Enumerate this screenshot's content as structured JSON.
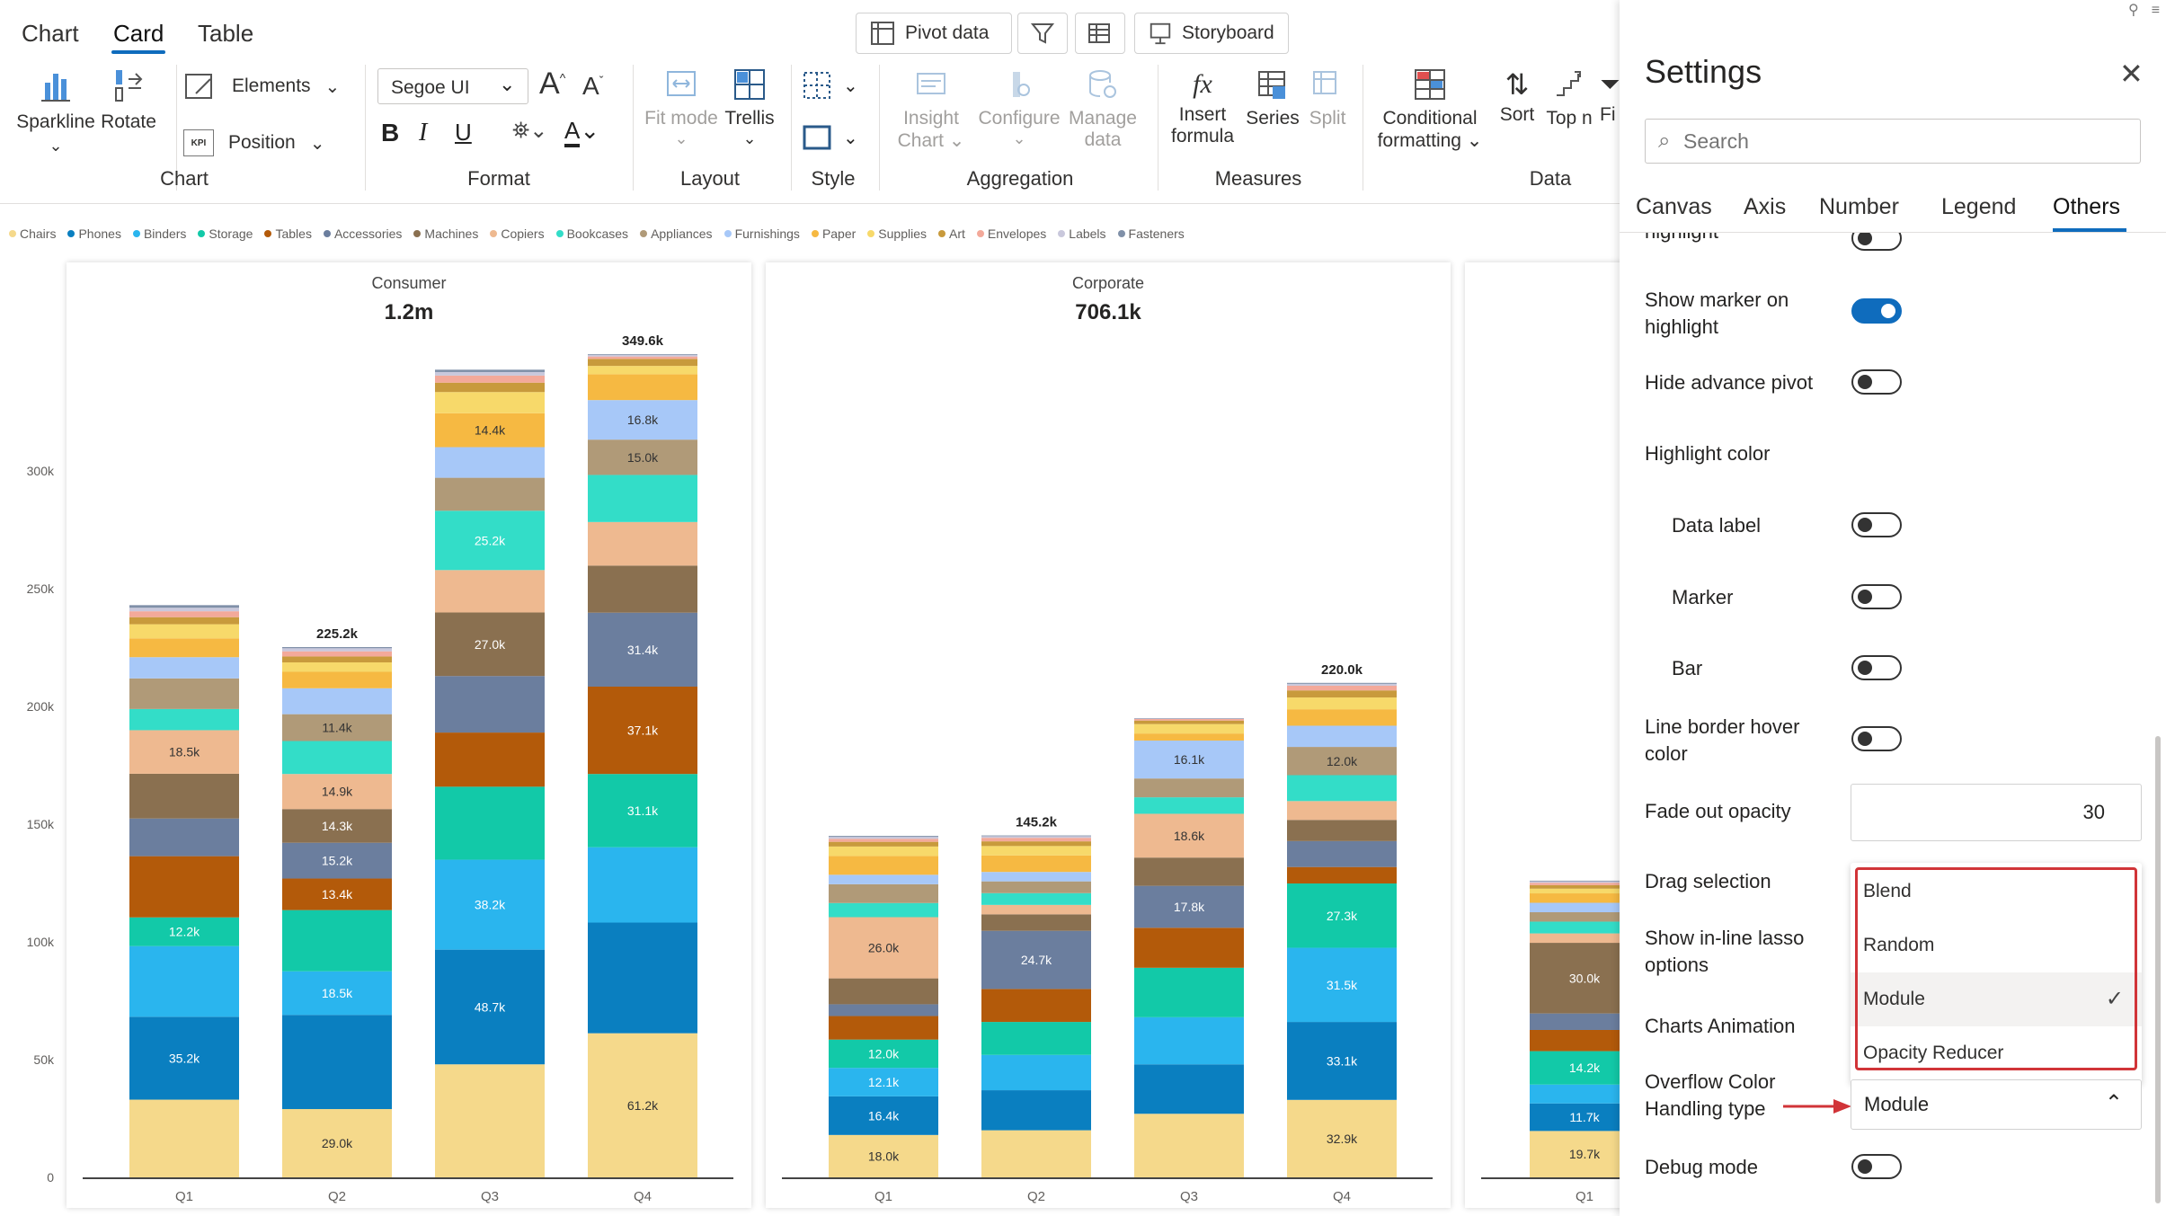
{
  "top_tabs": [
    "Chart",
    "Card",
    "Table"
  ],
  "top_buttons": {
    "pivot": "Pivot data",
    "storyboard": "Storyboard"
  },
  "ribbon": {
    "sparkline": "Sparkline",
    "rotate": "Rotate",
    "elements": "Elements",
    "position": "Position",
    "kpi": "KPI",
    "font_name": "Segoe UI",
    "fit_mode": "Fit mode",
    "trellis": "Trellis",
    "insight_chart_1": "Insight",
    "insight_chart_2": "Chart",
    "configure": "Configure",
    "manage_1": "Manage",
    "manage_2": "data",
    "insert_1": "Insert",
    "insert_2": "formula",
    "series": "Series",
    "split": "Split",
    "cond_1": "Conditional",
    "cond_2": "formatting",
    "sort": "Sort",
    "topn": "Top n",
    "fi": "Fi",
    "groups": {
      "chart": "Chart",
      "format": "Format",
      "layout": "Layout",
      "style": "Style",
      "aggregation": "Aggregation",
      "measures": "Measures",
      "data": "Data"
    }
  },
  "legend": [
    {
      "name": "Chairs",
      "color": "#f5d98b"
    },
    {
      "name": "Phones",
      "color": "#0a7fc0"
    },
    {
      "name": "Binders",
      "color": "#2ab5ee"
    },
    {
      "name": "Storage",
      "color": "#12c9a8"
    },
    {
      "name": "Tables",
      "color": "#b35a0a"
    },
    {
      "name": "Accessories",
      "color": "#6b7e9e"
    },
    {
      "name": "Machines",
      "color": "#8a7050"
    },
    {
      "name": "Copiers",
      "color": "#eeb990"
    },
    {
      "name": "Bookcases",
      "color": "#33ddc8"
    },
    {
      "name": "Appliances",
      "color": "#b09a78"
    },
    {
      "name": "Furnishings",
      "color": "#a7c8f8"
    },
    {
      "name": "Paper",
      "color": "#f6b942"
    },
    {
      "name": "Supplies",
      "color": "#f7d96a"
    },
    {
      "name": "Art",
      "color": "#c89a3c"
    },
    {
      "name": "Envelopes",
      "color": "#f3a99a"
    },
    {
      "name": "Labels",
      "color": "#c9c8dc"
    },
    {
      "name": "Fasteners",
      "color": "#8090a8"
    }
  ],
  "y_axis": [
    "300k",
    "250k",
    "200k",
    "150k",
    "100k",
    "50k",
    "0"
  ],
  "chart_data": [
    {
      "type": "bar",
      "title": "Consumer",
      "subtitle": "1.2m",
      "categories": [
        "Q1",
        "Q2",
        "Q3",
        "Q4"
      ],
      "ylim": [
        0,
        370000
      ],
      "stack_order": [
        "Chairs",
        "Phones",
        "Binders",
        "Storage",
        "Tables",
        "Accessories",
        "Machines",
        "Copiers",
        "Bookcases",
        "Appliances",
        "Furnishings",
        "Paper",
        "Supplies",
        "Art",
        "Envelopes",
        "Labels",
        "Fasteners"
      ],
      "bars": [
        {
          "total": 243000,
          "total_label": "",
          "segments": [
            [
              33000,
              ""
            ],
            [
              35200,
              "35.2k"
            ],
            [
              30000,
              ""
            ],
            [
              12200,
              "12.2k"
            ],
            [
              26000,
              ""
            ],
            [
              16000,
              ""
            ],
            [
              19000,
              ""
            ],
            [
              18500,
              "18.5k"
            ],
            [
              9000,
              ""
            ],
            [
              13000,
              ""
            ],
            [
              9000,
              ""
            ],
            [
              8000,
              ""
            ],
            [
              6000,
              ""
            ],
            [
              3000,
              ""
            ],
            [
              2500,
              ""
            ],
            [
              1500,
              ""
            ],
            [
              1100,
              ""
            ]
          ]
        },
        {
          "total": 225200,
          "total_label": "225.2k",
          "segments": [
            [
              29000,
              "29.0k"
            ],
            [
              40000,
              ""
            ],
            [
              18500,
              "18.5k"
            ],
            [
              26000,
              ""
            ],
            [
              13400,
              "13.4k"
            ],
            [
              15200,
              "15.2k"
            ],
            [
              14300,
              "14.3k"
            ],
            [
              14900,
              "14.9k"
            ],
            [
              14000,
              ""
            ],
            [
              11400,
              "11.4k"
            ],
            [
              11000,
              ""
            ],
            [
              7000,
              ""
            ],
            [
              4000,
              ""
            ],
            [
              2500,
              ""
            ],
            [
              2200,
              ""
            ],
            [
              1300,
              ""
            ],
            [
              500,
              ""
            ]
          ]
        },
        {
          "total": 343000,
          "total_label": "",
          "segments": [
            [
              48000,
              ""
            ],
            [
              48700,
              "48.7k"
            ],
            [
              38200,
              "38.2k"
            ],
            [
              31000,
              ""
            ],
            [
              23000,
              ""
            ],
            [
              24000,
              ""
            ],
            [
              27000,
              "27.0k"
            ],
            [
              18000,
              ""
            ],
            [
              25200,
              "25.2k"
            ],
            [
              14000,
              ""
            ],
            [
              13000,
              ""
            ],
            [
              14400,
              "14.4k"
            ],
            [
              9000,
              ""
            ],
            [
              4000,
              ""
            ],
            [
              3000,
              ""
            ],
            [
              1500,
              ""
            ],
            [
              1000,
              ""
            ]
          ]
        },
        {
          "total": 349600,
          "total_label": "349.6k",
          "segments": [
            [
              61200,
              "61.2k"
            ],
            [
              47000,
              ""
            ],
            [
              32000,
              ""
            ],
            [
              31100,
              "31.1k"
            ],
            [
              37100,
              "37.1k"
            ],
            [
              31400,
              "31.4k"
            ],
            [
              20000,
              ""
            ],
            [
              18500,
              ""
            ],
            [
              20000,
              ""
            ],
            [
              15000,
              "15.0k"
            ],
            [
              16800,
              "16.8k"
            ],
            [
              11000,
              ""
            ],
            [
              3500,
              ""
            ],
            [
              3000,
              ""
            ],
            [
              1000,
              ""
            ],
            [
              700,
              ""
            ],
            [
              300,
              ""
            ]
          ]
        }
      ]
    },
    {
      "type": "bar",
      "title": "Corporate",
      "subtitle": "706.1k",
      "categories": [
        "Q1",
        "Q2",
        "Q3",
        "Q4"
      ],
      "ylim": [
        0,
        370000
      ],
      "stack_order": [
        "Chairs",
        "Phones",
        "Binders",
        "Storage",
        "Tables",
        "Accessories",
        "Machines",
        "Copiers",
        "Bookcases",
        "Appliances",
        "Furnishings",
        "Paper",
        "Supplies",
        "Art",
        "Envelopes",
        "Labels",
        "Fasteners"
      ],
      "bars": [
        {
          "total": 145000,
          "total_label": "",
          "segments": [
            [
              18000,
              "18.0k"
            ],
            [
              16400,
              "16.4k"
            ],
            [
              12100,
              "12.1k"
            ],
            [
              12000,
              "12.0k"
            ],
            [
              10000,
              ""
            ],
            [
              5000,
              ""
            ],
            [
              11000,
              ""
            ],
            [
              26000,
              "26.0k"
            ],
            [
              6000,
              ""
            ],
            [
              8000,
              ""
            ],
            [
              4000,
              ""
            ],
            [
              8000,
              ""
            ],
            [
              4000,
              ""
            ],
            [
              2000,
              ""
            ],
            [
              1300,
              ""
            ],
            [
              800,
              ""
            ],
            [
              400,
              ""
            ]
          ]
        },
        {
          "total": 145200,
          "total_label": "145.2k",
          "segments": [
            [
              20000,
              ""
            ],
            [
              17000,
              ""
            ],
            [
              15000,
              ""
            ],
            [
              14000,
              ""
            ],
            [
              14000,
              ""
            ],
            [
              24700,
              "24.7k"
            ],
            [
              7000,
              ""
            ],
            [
              4000,
              ""
            ],
            [
              5000,
              ""
            ],
            [
              5000,
              ""
            ],
            [
              4000,
              ""
            ],
            [
              7000,
              ""
            ],
            [
              4000,
              ""
            ],
            [
              2000,
              ""
            ],
            [
              1500,
              ""
            ],
            [
              700,
              ""
            ],
            [
              300,
              ""
            ]
          ]
        },
        {
          "total": 195000,
          "total_label": "",
          "segments": [
            [
              27000,
              ""
            ],
            [
              21000,
              ""
            ],
            [
              20000,
              ""
            ],
            [
              21000,
              ""
            ],
            [
              17000,
              ""
            ],
            [
              17800,
              "17.8k"
            ],
            [
              12000,
              ""
            ],
            [
              18600,
              "18.6k"
            ],
            [
              7000,
              ""
            ],
            [
              8000,
              ""
            ],
            [
              16100,
              "16.1k"
            ],
            [
              3000,
              ""
            ],
            [
              4000,
              ""
            ],
            [
              1500,
              ""
            ],
            [
              700,
              ""
            ],
            [
              200,
              ""
            ],
            [
              100,
              ""
            ]
          ]
        },
        {
          "total": 220000,
          "total_label": "220.0k",
          "segments": [
            [
              32900,
              "32.9k"
            ],
            [
              33100,
              "33.1k"
            ],
            [
              31500,
              "31.5k"
            ],
            [
              27300,
              "27.3k"
            ],
            [
              7000,
              ""
            ],
            [
              11000,
              ""
            ],
            [
              9000,
              ""
            ],
            [
              8000,
              ""
            ],
            [
              11000,
              ""
            ],
            [
              12000,
              "12.0k"
            ],
            [
              9000,
              ""
            ],
            [
              7000,
              ""
            ],
            [
              5000,
              ""
            ],
            [
              3000,
              ""
            ],
            [
              2000,
              ""
            ],
            [
              800,
              ""
            ],
            [
              400,
              ""
            ]
          ]
        }
      ]
    },
    {
      "type": "bar",
      "title": "",
      "subtitle": "",
      "categories": [
        "Q1"
      ],
      "ylim": [
        0,
        370000
      ],
      "stack_order": [
        "Chairs",
        "Phones",
        "Binders",
        "Storage",
        "Tables",
        "Accessories",
        "Machines",
        "Copiers",
        "Bookcases",
        "Appliances",
        "Furnishings",
        "Paper",
        "Supplies",
        "Art",
        "Envelopes",
        "Labels",
        "Fasteners"
      ],
      "bars": [
        {
          "total": 126000,
          "total_label": "",
          "segments": [
            [
              19700,
              "19.7k"
            ],
            [
              11700,
              "11.7k"
            ],
            [
              8000,
              ""
            ],
            [
              14200,
              "14.2k"
            ],
            [
              9000,
              ""
            ],
            [
              7000,
              ""
            ],
            [
              30000,
              "30.0k"
            ],
            [
              4000,
              ""
            ],
            [
              5000,
              ""
            ],
            [
              4000,
              ""
            ],
            [
              4000,
              ""
            ],
            [
              4000,
              ""
            ],
            [
              2000,
              ""
            ],
            [
              1500,
              ""
            ],
            [
              1000,
              ""
            ],
            [
              600,
              ""
            ],
            [
              300,
              ""
            ]
          ]
        }
      ]
    }
  ],
  "settings": {
    "title": "Settings",
    "search_placeholder": "Search",
    "tabs": [
      "Canvas",
      "Axis",
      "Number",
      "Legend",
      "Others"
    ],
    "active_tab": "Others",
    "rows": {
      "partial": "highlight",
      "marker": "Show marker on highlight",
      "hide_pivot": "Hide advance pivot",
      "highlight_color": "Highlight color",
      "data_label": "Data label",
      "marker_sub": "Marker",
      "bar": "Bar",
      "line_border": "Line border hover color",
      "fade": "Fade out opacity",
      "fade_value": "30",
      "drag": "Drag selection",
      "lasso": "Show in-line lasso options",
      "animation": "Charts Animation",
      "overflow": "Overflow Color Handling type",
      "debug": "Debug mode"
    },
    "dropdown_options": [
      "Blend",
      "Random",
      "Module",
      "Opacity Reducer"
    ],
    "dropdown_selected": "Module",
    "highlight_color": "#d13438",
    "accent": "#0f6cbd"
  }
}
